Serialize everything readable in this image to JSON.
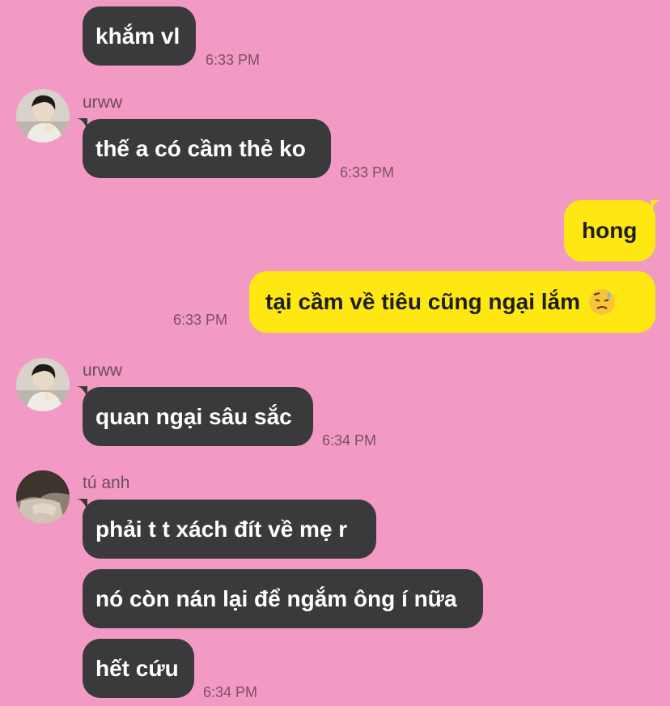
{
  "colors": {
    "background": "#f29ac3",
    "incoming_bubble": "#3a3a3c",
    "outgoing_bubble": "#ffe812",
    "timestamp": "#7c5066",
    "sender_name": "#6e4a5c"
  },
  "messages": {
    "m1": {
      "text": "khắm vl",
      "time": "6:33 PM"
    },
    "g1": {
      "sender": "urww",
      "text": "thế a có cầm thẻ ko",
      "time": "6:33 PM"
    },
    "me1": {
      "text": "hong"
    },
    "me2": {
      "text": "tại cầm về tiêu cũng ngại lắm",
      "emoji": "😓",
      "time": "6:33 PM"
    },
    "g2": {
      "sender": "urww",
      "text": "quan ngại sâu sắc",
      "time": "6:34 PM"
    },
    "g3": {
      "sender": "tú anh",
      "texts": [
        "phải t t xách đít về mẹ r",
        "nó còn nán lại để ngắm ông í nữa",
        "hết cứu"
      ],
      "time": "6:34 PM"
    }
  },
  "icons": {
    "urww_avatar": "person-avatar-icon",
    "tu_anh_avatar": "person-avatar-icon",
    "emoji": "downcast-face-with-sweat"
  }
}
